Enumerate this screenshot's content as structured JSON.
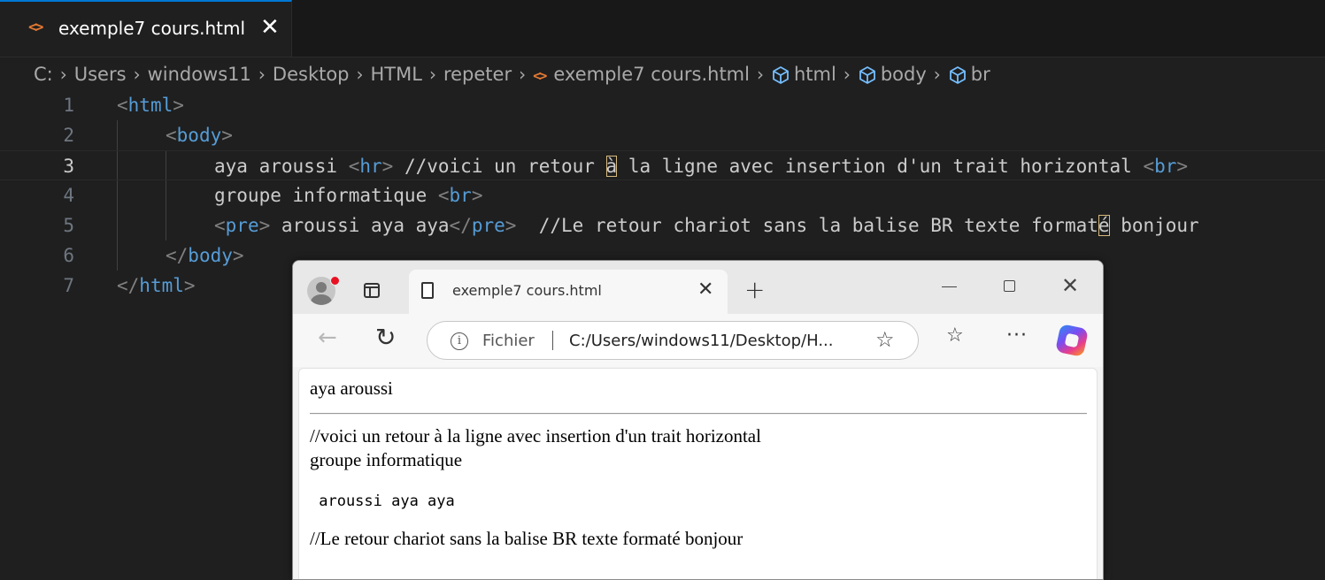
{
  "editor": {
    "tab": {
      "label": "exemple7 cours.html",
      "close": "✕"
    },
    "breadcrumb": [
      "C:",
      "Users",
      "windows11",
      "Desktop",
      "HTML",
      "repeter",
      "exemple7 cours.html",
      "html",
      "body",
      "br"
    ],
    "lines": [
      {
        "n": "1",
        "segs": [
          [
            "b",
            "<"
          ],
          [
            "n",
            "html"
          ],
          [
            "b",
            ">"
          ]
        ]
      },
      {
        "n": "2",
        "segs": [
          [
            "b",
            "<"
          ],
          [
            "n",
            "body"
          ],
          [
            "b",
            ">"
          ]
        ]
      },
      {
        "n": "3",
        "segs": [
          [
            "t",
            "aya aroussi "
          ],
          [
            "b",
            "<"
          ],
          [
            "n",
            "hr"
          ],
          [
            "b",
            ">"
          ],
          [
            "t",
            " //voici un retour "
          ],
          [
            "c",
            "à"
          ],
          [
            "t",
            " la ligne avec insertion d'un trait horizontal "
          ],
          [
            "b",
            "<"
          ],
          [
            "n",
            "br"
          ],
          [
            "b",
            ">"
          ]
        ]
      },
      {
        "n": "4",
        "segs": [
          [
            "t",
            "groupe informatique "
          ],
          [
            "b",
            "<"
          ],
          [
            "n",
            "br"
          ],
          [
            "b",
            ">"
          ]
        ]
      },
      {
        "n": "5",
        "segs": [
          [
            "b",
            "<"
          ],
          [
            "n",
            "pre"
          ],
          [
            "b",
            ">"
          ],
          [
            "t",
            " aroussi aya aya"
          ],
          [
            "b",
            "</"
          ],
          [
            "n",
            "pre"
          ],
          [
            "b",
            ">"
          ],
          [
            "t",
            "  //Le retour chariot sans la balise BR texte format"
          ],
          [
            "c",
            "é"
          ],
          [
            "t",
            " bonjour"
          ]
        ]
      },
      {
        "n": "6",
        "segs": [
          [
            "b",
            "</"
          ],
          [
            "n",
            "body"
          ],
          [
            "b",
            ">"
          ]
        ]
      },
      {
        "n": "7",
        "segs": [
          [
            "b",
            "</"
          ],
          [
            "n",
            "html"
          ],
          [
            "b",
            ">"
          ]
        ]
      }
    ],
    "colors": {
      "tag_bracket": "#808080",
      "tag_name": "#569cd6",
      "text": "#cccccc",
      "accent": "#0078d4",
      "html_icon": "#e37933"
    }
  },
  "browser": {
    "tab_title": "exemple7 cours.html",
    "address_label": "Fichier",
    "url": "C:/Users/windows11/Desktop/H...",
    "icons": [
      "profile-icon",
      "tab-actions-icon",
      "page-icon",
      "close-icon",
      "new-tab-icon",
      "minimize-icon",
      "maximize-icon",
      "back-icon",
      "reload-icon",
      "info-icon",
      "favorite-star-icon",
      "favorites-icon",
      "more-icon",
      "copilot-icon"
    ],
    "page": {
      "line1": "aya aroussi",
      "line2": "//voici un retour à la ligne avec insertion d'un trait horizontal",
      "line3": "groupe informatique",
      "pre": " aroussi aya aya",
      "line4": "//Le retour chariot sans la balise BR texte formaté bonjour"
    }
  }
}
